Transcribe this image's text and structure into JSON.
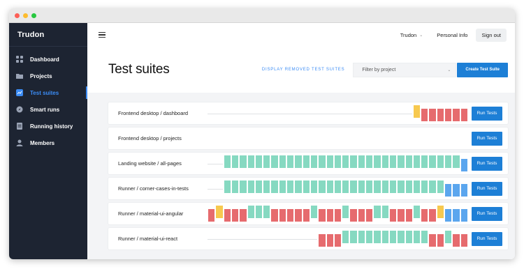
{
  "app": {
    "brand": "Trudon"
  },
  "colors": {
    "pass": "#86d9c1",
    "fail": "#e66b6e",
    "flaky": "#f7c94f",
    "running": "#5ba6ee",
    "primary": "#1d7fd6",
    "sidebar": "#1d2432"
  },
  "sidebar": {
    "items": [
      {
        "label": "Dashboard",
        "icon": "grid-icon",
        "active": false
      },
      {
        "label": "Projects",
        "icon": "folder-icon",
        "active": false
      },
      {
        "label": "Test suites",
        "icon": "chart-icon",
        "active": true
      },
      {
        "label": "Smart runs",
        "icon": "compass-icon",
        "active": false
      },
      {
        "label": "Running history",
        "icon": "document-icon",
        "active": false
      },
      {
        "label": "Members",
        "icon": "person-icon",
        "active": false
      }
    ]
  },
  "topbar": {
    "user": "Trudon",
    "personal_info": "Personal Info",
    "sign_out": "Sign out"
  },
  "header": {
    "title": "Test suites",
    "removed_link": "DISPLAY REMOVED TEST SUITES",
    "filter_placeholder": "Filter by project",
    "create_button": "Create Test Suite"
  },
  "suites": [
    {
      "name": "Frontend desktop / dashboard",
      "run_label": "Run Tests",
      "history": [
        "flaky",
        "fail",
        "fail",
        "fail",
        "fail",
        "fail",
        "fail"
      ]
    },
    {
      "name": "Frontend desktop / projects",
      "run_label": "Run Tests",
      "history": []
    },
    {
      "name": "Landing website / all-pages",
      "run_label": "Run Tests",
      "history": [
        "pass",
        "pass",
        "pass",
        "pass",
        "pass",
        "pass",
        "pass",
        "pass",
        "pass",
        "pass",
        "pass",
        "pass",
        "pass",
        "pass",
        "pass",
        "pass",
        "pass",
        "pass",
        "pass",
        "pass",
        "pass",
        "pass",
        "pass",
        "pass",
        "pass",
        "pass",
        "pass",
        "pass",
        "pass",
        "pass",
        "running"
      ]
    },
    {
      "name": "Runner / corner-cases-in-tests",
      "run_label": "Run Tests",
      "history": [
        "pass",
        "pass",
        "pass",
        "pass",
        "pass",
        "pass",
        "pass",
        "pass",
        "pass",
        "pass",
        "pass",
        "pass",
        "pass",
        "pass",
        "pass",
        "pass",
        "pass",
        "pass",
        "pass",
        "pass",
        "pass",
        "pass",
        "pass",
        "pass",
        "pass",
        "pass",
        "pass",
        "pass",
        "running",
        "running",
        "running"
      ]
    },
    {
      "name": "Runner / material-ui-angular",
      "run_label": "Run Tests",
      "history": [
        "fail",
        "flaky",
        "fail",
        "fail",
        "fail",
        "pass",
        "pass",
        "pass",
        "fail",
        "fail",
        "fail",
        "fail",
        "fail",
        "pass",
        "fail",
        "fail",
        "fail",
        "pass",
        "fail",
        "fail",
        "fail",
        "pass",
        "pass",
        "fail",
        "fail",
        "fail",
        "pass",
        "fail",
        "fail",
        "flaky",
        "running",
        "running",
        "running"
      ]
    },
    {
      "name": "Runner / material-ui-react",
      "run_label": "Run Tests",
      "history": [
        "fail",
        "fail",
        "fail",
        "pass",
        "pass",
        "pass",
        "pass",
        "pass",
        "pass",
        "pass",
        "pass",
        "pass",
        "pass",
        "pass",
        "fail",
        "fail",
        "pass",
        "fail",
        "fail"
      ]
    }
  ]
}
